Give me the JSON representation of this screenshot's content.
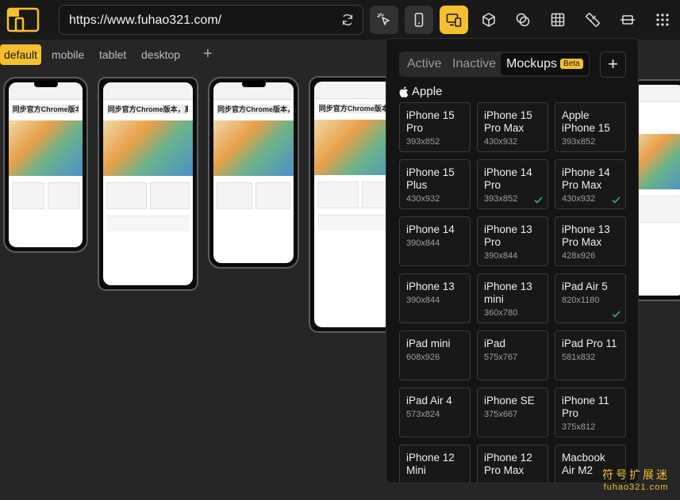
{
  "toolbar": {
    "url": "https://www.fuhao321.com/"
  },
  "tabs": {
    "items": [
      "default",
      "mobile",
      "tablet",
      "desktop"
    ],
    "plus": "+"
  },
  "preview": {
    "headline": "同步官方Chrome版本，离"
  },
  "panel": {
    "segments": [
      "Active",
      "Inactive",
      "Mockups"
    ],
    "beta_label": "Beta",
    "add_label": "+",
    "group_title": "Apple",
    "devices": [
      {
        "name": "iPhone 15 Pro",
        "size": "393x852",
        "checked": false
      },
      {
        "name": "iPhone 15 Pro Max",
        "size": "430x932",
        "checked": false
      },
      {
        "name": "Apple iPhone 15",
        "size": "393x852",
        "checked": false
      },
      {
        "name": "iPhone 15 Plus",
        "size": "430x932",
        "checked": false
      },
      {
        "name": "iPhone 14 Pro",
        "size": "393x852",
        "checked": true
      },
      {
        "name": "iPhone 14 Pro Max",
        "size": "430x932",
        "checked": true
      },
      {
        "name": "iPhone 14",
        "size": "390x844",
        "checked": false
      },
      {
        "name": "iPhone 13 Pro",
        "size": "390x844",
        "checked": false
      },
      {
        "name": "iPhone 13 Pro Max",
        "size": "428x926",
        "checked": false
      },
      {
        "name": "iPhone 13",
        "size": "390x844",
        "checked": false
      },
      {
        "name": "iPhone 13 mini",
        "size": "360x780",
        "checked": false
      },
      {
        "name": "iPad Air 5",
        "size": "820x1180",
        "checked": true
      },
      {
        "name": "iPad mini",
        "size": "608x926",
        "checked": false
      },
      {
        "name": "iPad",
        "size": "575x767",
        "checked": false
      },
      {
        "name": "iPad Pro 11",
        "size": "581x832",
        "checked": false
      },
      {
        "name": "iPad Air 4",
        "size": "573x824",
        "checked": false
      },
      {
        "name": "iPhone SE",
        "size": "375x667",
        "checked": false
      },
      {
        "name": "iPhone 11 Pro",
        "size": "375x812",
        "checked": false
      },
      {
        "name": "iPhone 12 Mini",
        "size": "",
        "checked": false
      },
      {
        "name": "iPhone 12 Pro Max",
        "size": "",
        "checked": false
      },
      {
        "name": "Macbook Air M2",
        "size": "",
        "checked": false
      }
    ]
  },
  "watermark": {
    "line1": "符号扩展迷",
    "line2": "fuhao321.com"
  },
  "colors": {
    "accent": "#f5c02d",
    "background": "#262626",
    "check": "#3fbf7f"
  }
}
